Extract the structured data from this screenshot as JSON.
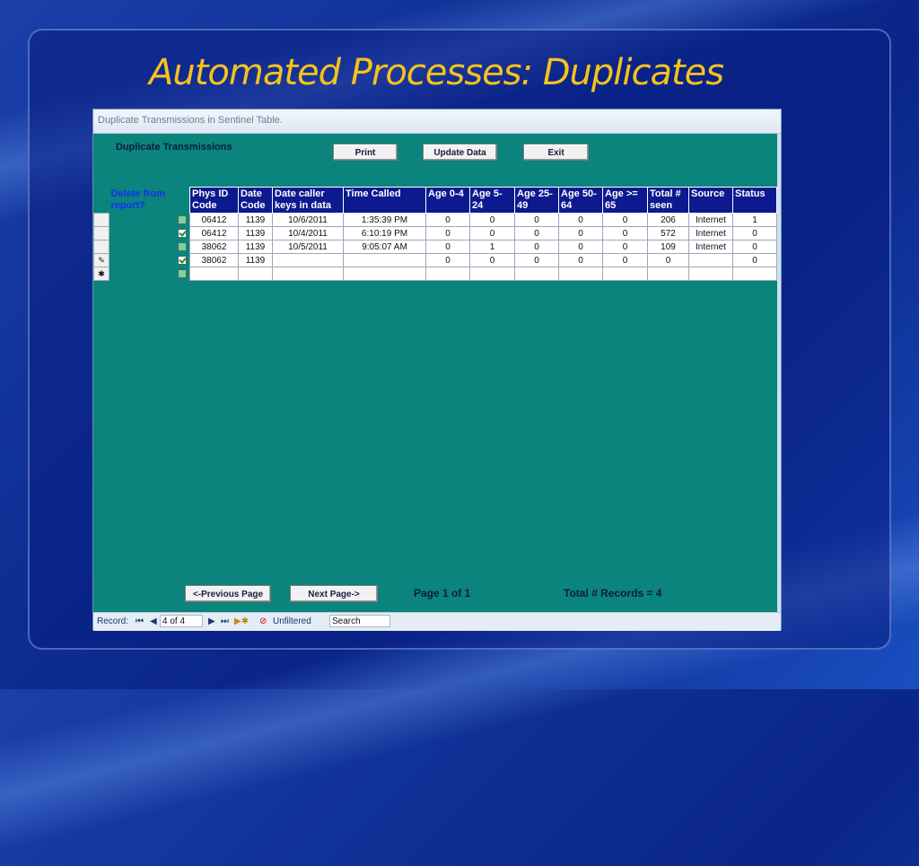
{
  "slide": {
    "title": "Automated Processes: Duplicates"
  },
  "window": {
    "title": "Duplicate Transmissions in Sentinel Table."
  },
  "form": {
    "heading": "Duplicate Transmissions",
    "buttons": {
      "print": "Print",
      "update": "Update Data",
      "exit": "Exit",
      "prev": "<-Previous Page",
      "next": "Next Page->"
    },
    "page_info": "Page 1 of 1",
    "total_records": "Total # Records =  4"
  },
  "grid": {
    "delete_header": "Delete from report?",
    "columns": [
      "Phys ID Code",
      "Date Code",
      "Date caller keys in data",
      "Time Called",
      "Age  0-4",
      "Age  5-24",
      "Age 25-49",
      "Age 50-64",
      "Age >= 65",
      "Total # seen",
      "Source",
      "Status"
    ],
    "rows": [
      {
        "selector": "",
        "checked": false,
        "cells": [
          "06412",
          "1139",
          "10/6/2011",
          "1:35:39 PM",
          "0",
          "0",
          "0",
          "0",
          "0",
          "206",
          "Internet",
          "1"
        ]
      },
      {
        "selector": "",
        "checked": true,
        "cells": [
          "06412",
          "1139",
          "10/4/2011",
          "6:10:19 PM",
          "0",
          "0",
          "0",
          "0",
          "0",
          "572",
          "Internet",
          "0"
        ]
      },
      {
        "selector": "",
        "checked": false,
        "cells": [
          "38062",
          "1139",
          "10/5/2011",
          "9:05:07 AM",
          "0",
          "1",
          "0",
          "0",
          "0",
          "109",
          "Internet",
          "0"
        ]
      },
      {
        "selector": "✎",
        "checked": true,
        "cells": [
          "38062",
          "1139",
          "",
          "",
          "0",
          "0",
          "0",
          "0",
          "0",
          "0",
          "",
          "0"
        ]
      },
      {
        "selector": "✱",
        "checked": false,
        "cells": [
          "",
          "",
          "",
          "",
          "",
          "",
          "",
          "",
          "",
          "",
          "",
          ""
        ]
      }
    ]
  },
  "navigation": {
    "record_label": "Record:",
    "first": "⏮",
    "prev": "◀",
    "current": "4 of 4",
    "next": "▶",
    "last": "⏭",
    "new": "▶✱",
    "filter": "Unfiltered",
    "search": "Search"
  },
  "colors": {
    "title": "#f7c21b",
    "form_bg": "#0a847d",
    "header_bg": "#0d1a8f",
    "delete_header_text": "#1430ff"
  }
}
